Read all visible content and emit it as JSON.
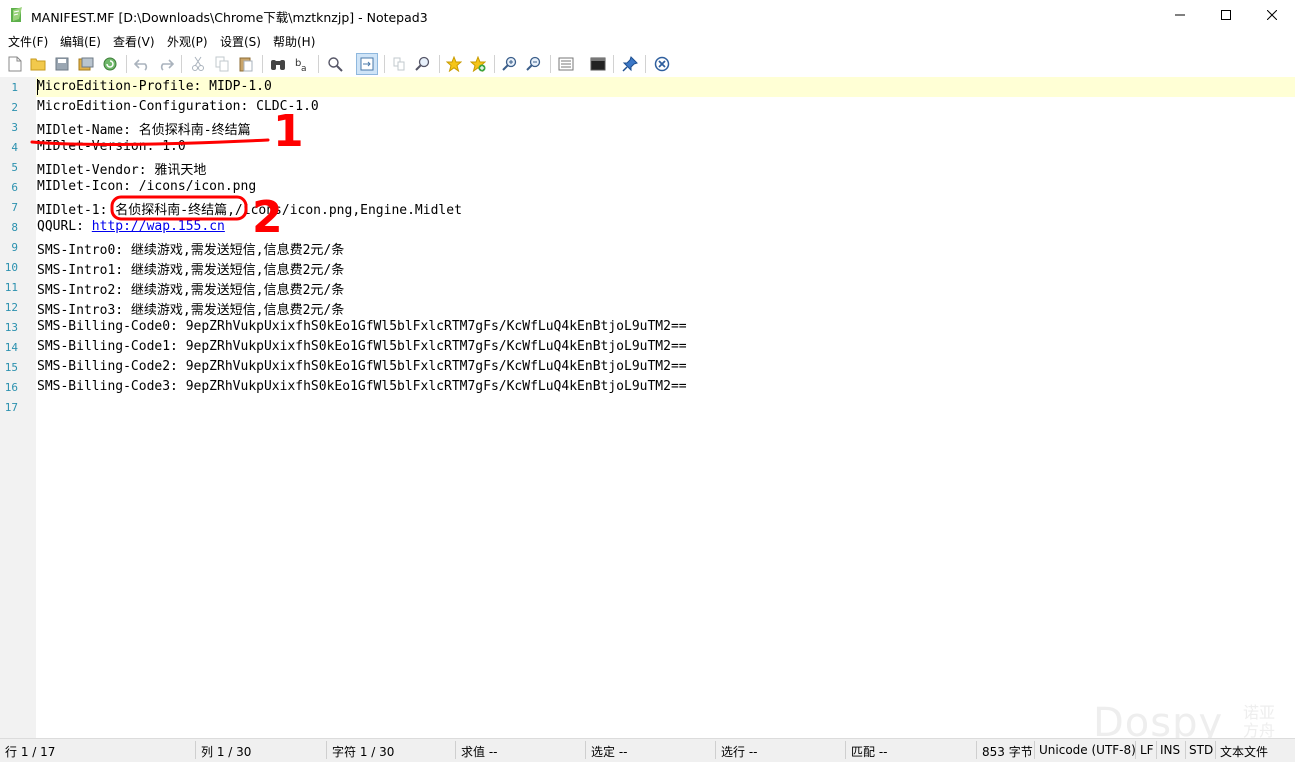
{
  "window": {
    "title": "MANIFEST.MF [D:\\Downloads\\Chrome下载\\mztknzjp] - Notepad3",
    "minimize_icon": "minimize-icon",
    "maximize_icon": "maximize-icon",
    "close_icon": "close-icon"
  },
  "menu": [
    "文件(F)",
    "编辑(E)",
    "查看(V)",
    "外观(P)",
    "设置(S)",
    "帮助(H)"
  ],
  "toolbar_icons": [
    "new-file-icon",
    "open-folder-icon",
    "save-icon",
    "save-as-icon",
    "revert-icon",
    "undo-icon",
    "redo-icon",
    "cut-icon",
    "copy-icon",
    "paste-icon",
    "find-icon",
    "replace-icon",
    "goto-icon",
    "word-wrap-icon",
    "column-icon",
    "zoom-find-icon",
    "favorites-icon",
    "add-favorite-icon",
    "zoom-in-icon",
    "zoom-out-icon",
    "scheme-icon",
    "console-icon",
    "pin-icon",
    "exit-icon"
  ],
  "editor": {
    "lines": [
      {
        "n": "1",
        "text": "MicroEdition-Profile: MIDP-1.0"
      },
      {
        "n": "2",
        "text": "MicroEdition-Configuration: CLDC-1.0"
      },
      {
        "n": "3",
        "text": "MIDlet-Name: 名侦探科南-终结篇"
      },
      {
        "n": "4",
        "text": "MIDlet-Version: 1.0"
      },
      {
        "n": "5",
        "text": "MIDlet-Vendor: 雅讯天地"
      },
      {
        "n": "6",
        "text": "MIDlet-Icon: /icons/icon.png"
      },
      {
        "n": "7",
        "text": "MIDlet-1: 名侦探科南-终结篇,/icons/icon.png,Engine.Midlet"
      },
      {
        "n": "8",
        "text": "QQURL: ",
        "link": "http://wap.155.cn"
      },
      {
        "n": "9",
        "text": "SMS-Intro0: 继续游戏,需发送短信,信息费2元/条"
      },
      {
        "n": "10",
        "text": "SMS-Intro1: 继续游戏,需发送短信,信息费2元/条"
      },
      {
        "n": "11",
        "text": "SMS-Intro2: 继续游戏,需发送短信,信息费2元/条"
      },
      {
        "n": "12",
        "text": "SMS-Intro3: 继续游戏,需发送短信,信息费2元/条"
      },
      {
        "n": "13",
        "text": "SMS-Billing-Code0: 9epZRhVukpUxixfhS0kEo1GfWl5blFxlcRTM7gFs/KcWfLuQ4kEnBtjoL9uTM2=="
      },
      {
        "n": "14",
        "text": "SMS-Billing-Code1: 9epZRhVukpUxixfhS0kEo1GfWl5blFxlcRTM7gFs/KcWfLuQ4kEnBtjoL9uTM2=="
      },
      {
        "n": "15",
        "text": "SMS-Billing-Code2: 9epZRhVukpUxixfhS0kEo1GfWl5blFxlcRTM7gFs/KcWfLuQ4kEnBtjoL9uTM2=="
      },
      {
        "n": "16",
        "text": "SMS-Billing-Code3: 9epZRhVukpUxixfhS0kEo1GfWl5blFxlcRTM7gFs/KcWfLuQ4kEnBtjoL9uTM2=="
      },
      {
        "n": "17",
        "text": ""
      }
    ]
  },
  "annotations": {
    "mark1": "1",
    "mark2": "2",
    "color": "#ff0000"
  },
  "watermark": {
    "text": "Dospy",
    "text2": "诺亚方舟"
  },
  "status": {
    "line": "行  1 / 17",
    "col": "列  1 / 30",
    "char": "字符  1 / 30",
    "eval": "求值  --",
    "sel": "选定  --",
    "sel_lines": "选行  --",
    "match": "匹配  --",
    "size": "853 字节",
    "encoding": "Unicode (UTF-8)",
    "eol": "LF",
    "ins": "INS",
    "std": "STD",
    "type": "文本文件"
  }
}
